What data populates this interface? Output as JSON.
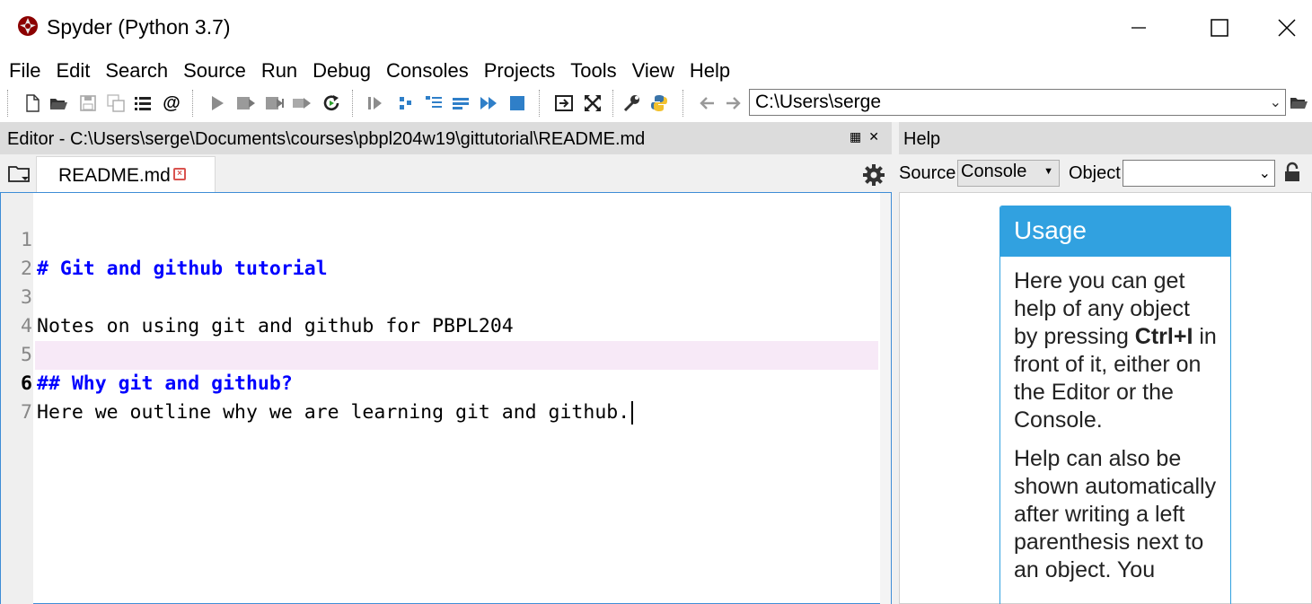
{
  "window": {
    "title": "Spyder (Python 3.7)",
    "icon": "spyder-logo-icon"
  },
  "menu": [
    "File",
    "Edit",
    "Search",
    "Source",
    "Run",
    "Debug",
    "Consoles",
    "Projects",
    "Tools",
    "View",
    "Help"
  ],
  "toolbar": {
    "path": "C:\\Users\\serge",
    "icons": [
      "new-file-icon",
      "open-file-icon",
      "save-icon",
      "save-all-icon",
      "outline-icon",
      "at-icon",
      "run-icon",
      "run-cell-icon",
      "run-cell-advance-icon",
      "run-selection-icon",
      "rerun-icon",
      "debug-icon",
      "step-icon",
      "step-into-icon",
      "step-return-icon",
      "continue-icon",
      "stop-icon",
      "maximize-pane-icon",
      "fullscreen-icon",
      "preferences-icon",
      "python-path-icon",
      "back-icon",
      "forward-icon",
      "browse-folder-icon"
    ]
  },
  "editor": {
    "header": "Editor - C:\\Users\\serge\\Documents\\courses\\pbpl204w19\\gittutorial\\README.md",
    "tab_label": "README.md",
    "lines": [
      {
        "num": "1",
        "text": "# Git and github tutorial",
        "style": "heading"
      },
      {
        "num": "2",
        "text": "",
        "style": "normal"
      },
      {
        "num": "3",
        "text": "Notes on using git and github for PBPL204",
        "style": "normal"
      },
      {
        "num": "4",
        "text": "",
        "style": "normal"
      },
      {
        "num": "5",
        "text": "## Why git and github?",
        "style": "heading"
      },
      {
        "num": "6",
        "text": "Here we outline why we are learning git and github.",
        "style": "current"
      },
      {
        "num": "7",
        "text": "",
        "style": "normal"
      }
    ]
  },
  "help": {
    "header": "Help",
    "source_label": "Source",
    "source_value": "Console",
    "object_label": "Object",
    "object_value": "",
    "usage_title": "Usage",
    "usage_p1_before": "Here you can get help of any object by pressing ",
    "usage_p1_bold": "Ctrl+I",
    "usage_p1_after": " in front of it, either on the Editor or the Console.",
    "usage_p2": "Help can also be shown automatically after writing a left parenthesis next to an object. You"
  },
  "colors": {
    "heading_blue": "#0000ff",
    "usage_blue": "#31a1e0",
    "current_line": "#f7e9f7",
    "header_gray": "#dcdcdc"
  }
}
